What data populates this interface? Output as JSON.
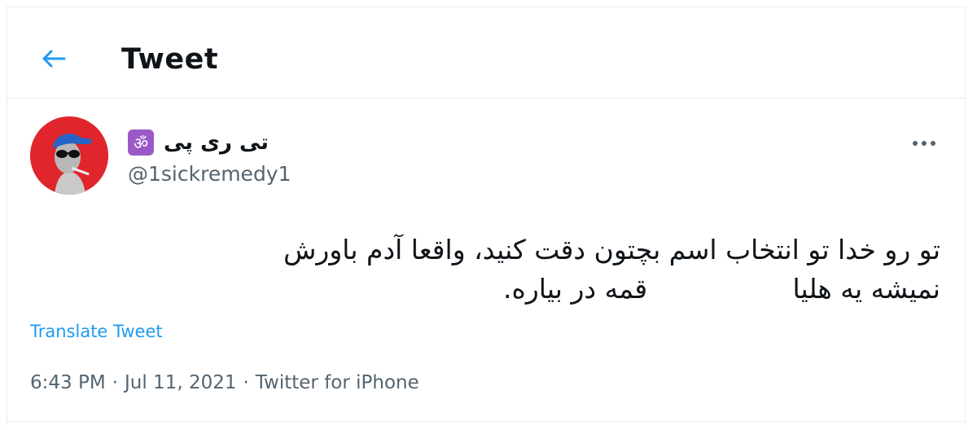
{
  "header": {
    "title": "Tweet",
    "back_icon": "arrow-left-icon",
    "accent": "#1d9bf0"
  },
  "tweet": {
    "author": {
      "display_name": "تی ری پی",
      "badge_glyph": "ॐ",
      "badge_color": "#9b59c8",
      "handle": "@1sickremedy1"
    },
    "text_lines": [
      "تو رو خدا تو انتخاب اسم بچتون دقت کنید، واقعا آدم باورش",
      "نمیشه یه هلیا                 قمه در بیاره."
    ],
    "translate_label": "Translate Tweet",
    "time": "6:43 PM",
    "date": "Jul 11, 2021",
    "source": "Twitter for iPhone",
    "separator": "·",
    "more_icon": "more-horizontal-icon"
  }
}
